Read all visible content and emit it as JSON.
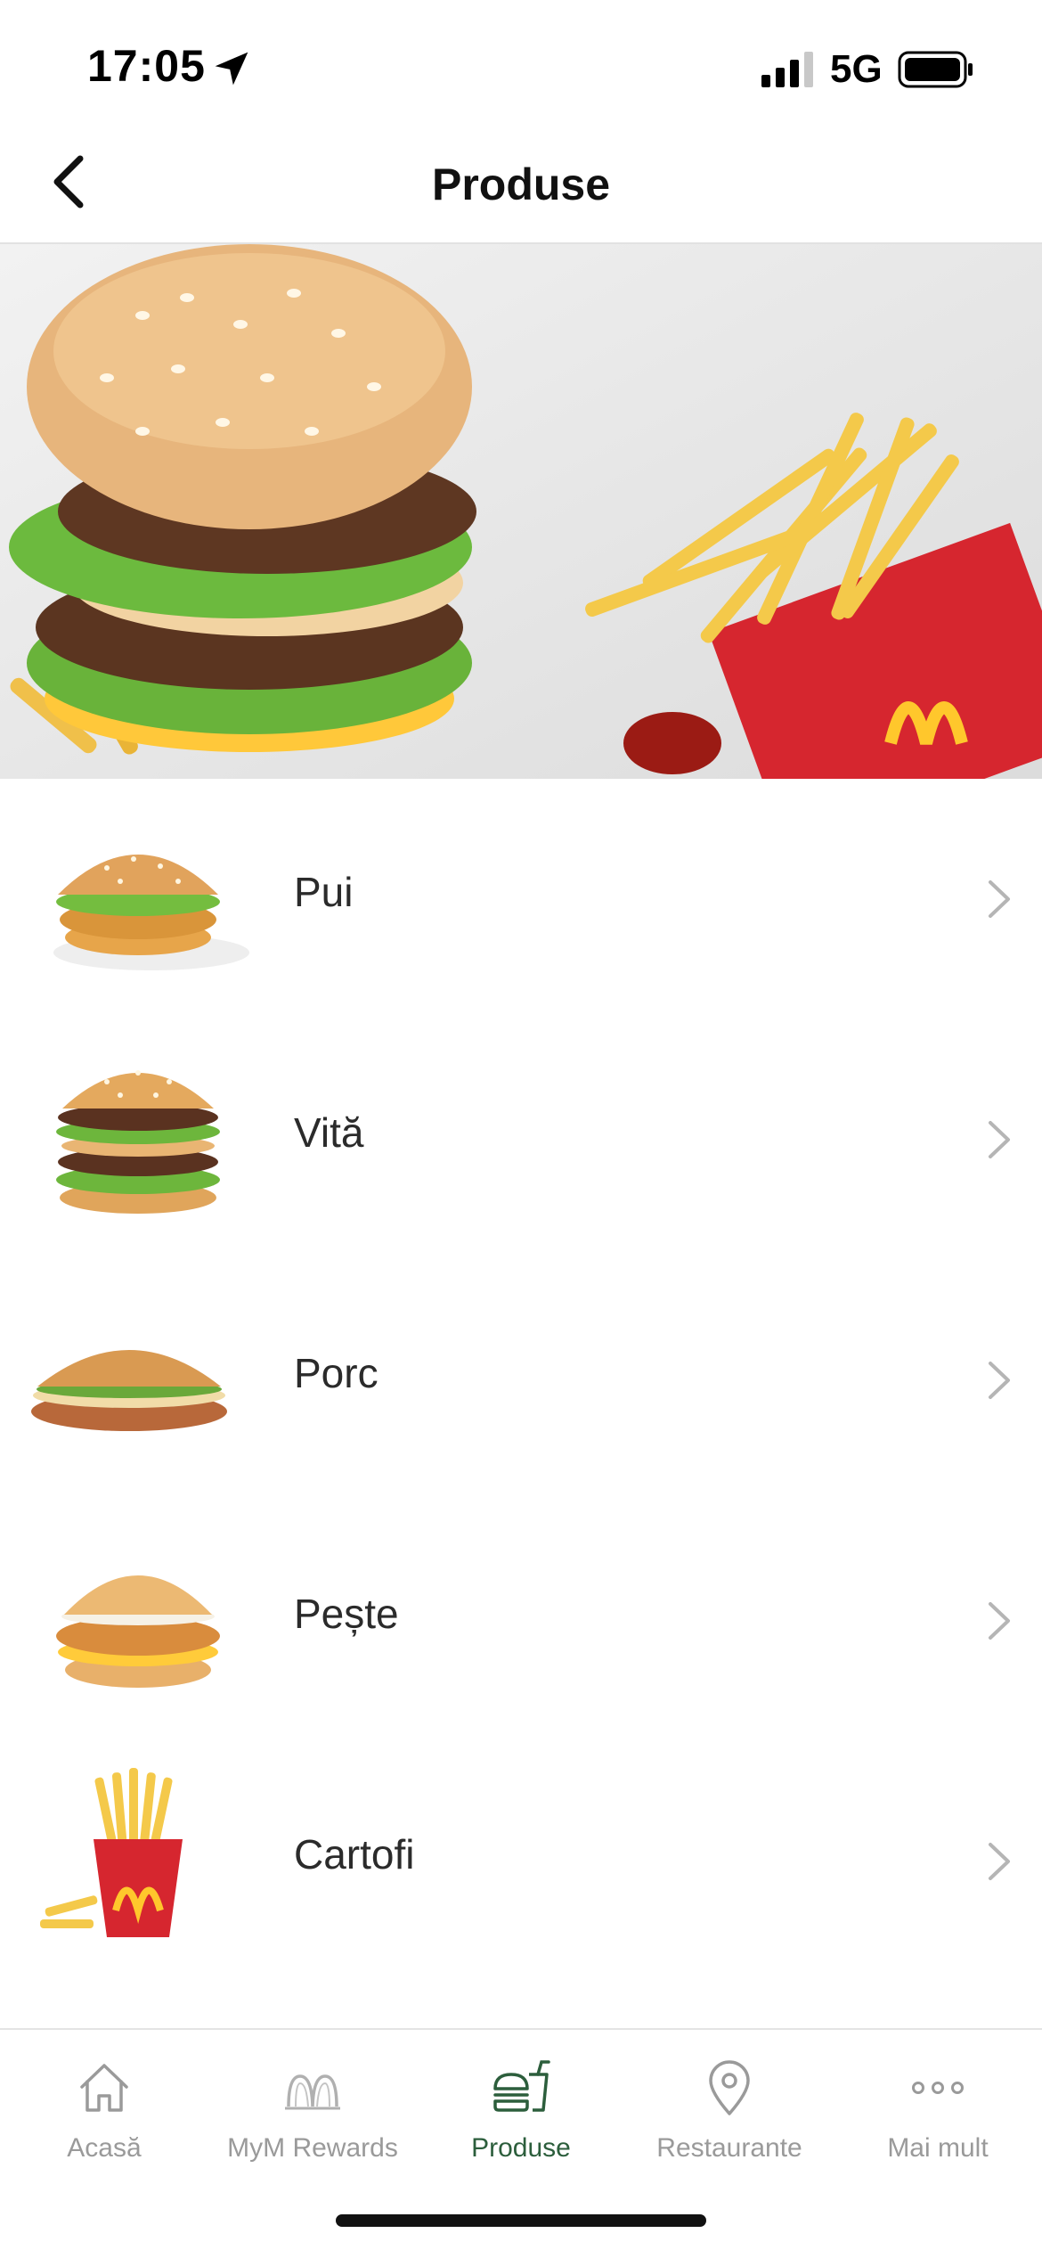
{
  "status": {
    "time": "17:05",
    "network": "5G"
  },
  "nav": {
    "title": "Produse"
  },
  "categories": [
    {
      "label": "Pui",
      "thumb": "chicken-burger"
    },
    {
      "label": "Vită",
      "thumb": "beef-double-burger"
    },
    {
      "label": "Porc",
      "thumb": "pork-sandwich"
    },
    {
      "label": "Pește",
      "thumb": "fish-burger"
    },
    {
      "label": "Cartofi",
      "thumb": "fries-box"
    }
  ],
  "tabs": [
    {
      "label": "Acasă",
      "icon": "home-icon",
      "active": false
    },
    {
      "label": "MyM Rewards",
      "icon": "arches-icon",
      "active": false
    },
    {
      "label": "Produse",
      "icon": "burger-drink-icon",
      "active": true
    },
    {
      "label": "Restaurante",
      "icon": "location-pin-icon",
      "active": false
    },
    {
      "label": "Mai mult",
      "icon": "more-dots-icon",
      "active": false
    }
  ],
  "colors": {
    "active_tab": "#2c5e3c",
    "inactive_tab": "#9a9a9a",
    "brand_red": "#c8102e",
    "brand_yellow": "#ffc72c"
  }
}
